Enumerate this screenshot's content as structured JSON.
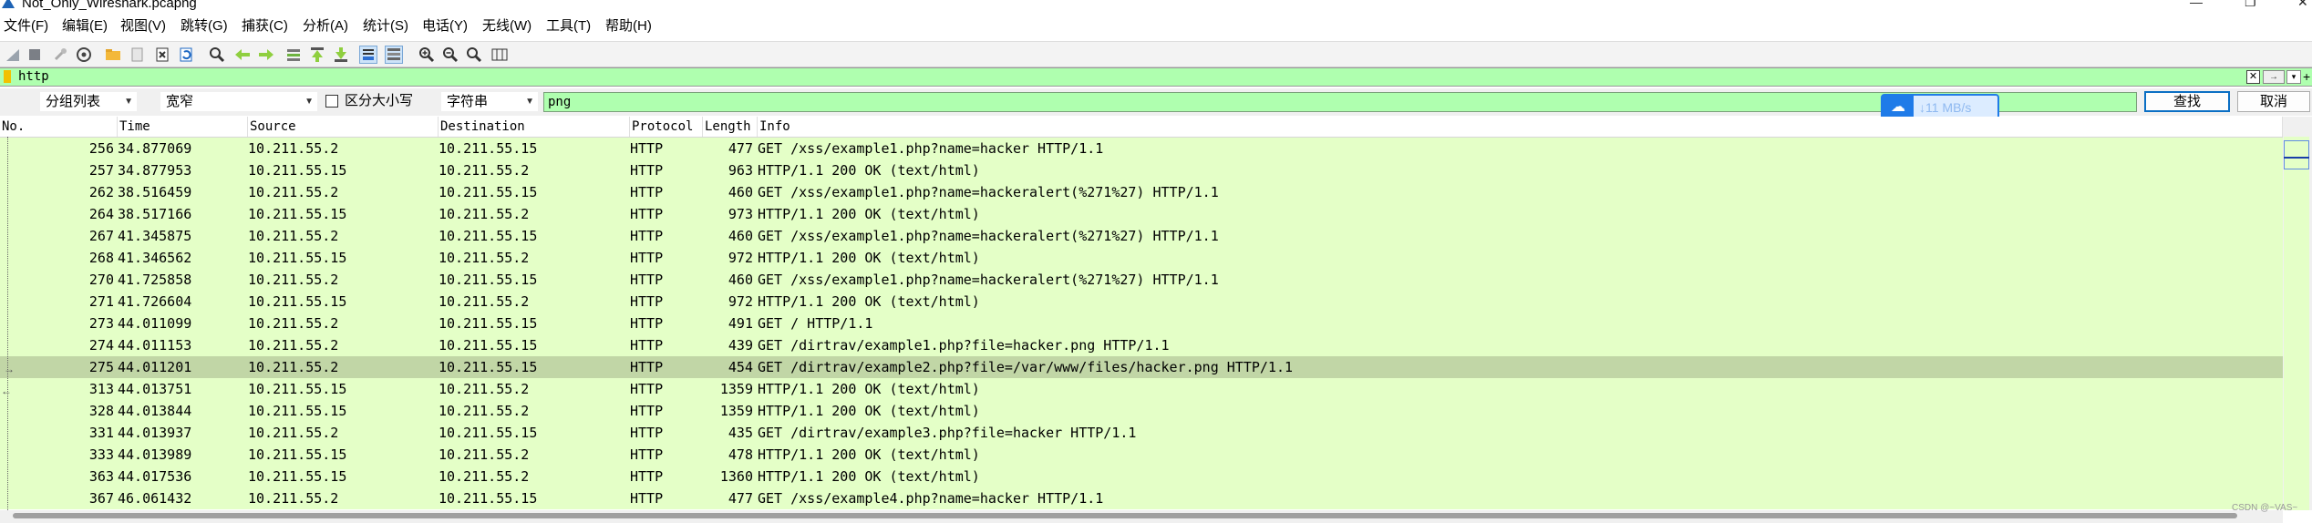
{
  "window": {
    "title": "Not_Only_Wireshark.pcapng",
    "minimize_glyph": "—",
    "maximize_glyph": "❐",
    "close_glyph": "✕"
  },
  "menu": [
    "文件(F)",
    "编辑(E)",
    "视图(V)",
    "跳转(G)",
    "捕获(C)",
    "分析(A)",
    "统计(S)",
    "电话(Y)",
    "无线(W)",
    "工具(T)",
    "帮助(H)"
  ],
  "toolbar_icons": [
    "shark-fin-icon",
    "stop-icon",
    "restart-icon",
    "options-icon",
    "open-folder-icon",
    "file-icon",
    "close-file-icon",
    "reload-icon",
    "find-icon",
    "back-icon",
    "forward-icon",
    "goto-icon",
    "first-icon",
    "last-icon",
    "autoscroll-icon",
    "colorize-icon",
    "zoom-in-icon",
    "zoom-out-icon",
    "zoom-normal-icon",
    "resize-columns-icon"
  ],
  "display_filter": {
    "value": "http",
    "clear_glyph": "✕",
    "apply_glyph": "→",
    "dropdown_glyph": "▾",
    "add_glyph": "+"
  },
  "find_bar": {
    "search_in": "分组列表",
    "char_width": "宽窄",
    "case_sensitive_label": "区分大小写",
    "search_type": "字符串",
    "search_value": "png",
    "find_button": "查找",
    "cancel_button": "取消"
  },
  "download_badge": {
    "speed": "↓11 MB/s"
  },
  "packet_list": {
    "columns": [
      "No.",
      "Time",
      "Source",
      "Destination",
      "Protocol",
      "Length",
      "Info"
    ],
    "rows": [
      {
        "no": "256",
        "time": "34.877069",
        "src": "10.211.55.2",
        "dst": "10.211.55.15",
        "proto": "HTTP",
        "len": "477",
        "info": "GET /xss/example1.php?name=hacker HTTP/1.1"
      },
      {
        "no": "257",
        "time": "34.877953",
        "src": "10.211.55.15",
        "dst": "10.211.55.2",
        "proto": "HTTP",
        "len": "963",
        "info": "HTTP/1.1 200 OK  (text/html)"
      },
      {
        "no": "262",
        "time": "38.516459",
        "src": "10.211.55.2",
        "dst": "10.211.55.15",
        "proto": "HTTP",
        "len": "460",
        "info": "GET /xss/example1.php?name=hackeralert(%271%27) HTTP/1.1"
      },
      {
        "no": "264",
        "time": "38.517166",
        "src": "10.211.55.15",
        "dst": "10.211.55.2",
        "proto": "HTTP",
        "len": "973",
        "info": "HTTP/1.1 200 OK  (text/html)"
      },
      {
        "no": "267",
        "time": "41.345875",
        "src": "10.211.55.2",
        "dst": "10.211.55.15",
        "proto": "HTTP",
        "len": "460",
        "info": "GET /xss/example1.php?name=hackeralert(%271%27) HTTP/1.1"
      },
      {
        "no": "268",
        "time": "41.346562",
        "src": "10.211.55.15",
        "dst": "10.211.55.2",
        "proto": "HTTP",
        "len": "972",
        "info": "HTTP/1.1 200 OK  (text/html)"
      },
      {
        "no": "270",
        "time": "41.725858",
        "src": "10.211.55.2",
        "dst": "10.211.55.15",
        "proto": "HTTP",
        "len": "460",
        "info": "GET /xss/example1.php?name=hackeralert(%271%27) HTTP/1.1"
      },
      {
        "no": "271",
        "time": "41.726604",
        "src": "10.211.55.15",
        "dst": "10.211.55.2",
        "proto": "HTTP",
        "len": "972",
        "info": "HTTP/1.1 200 OK  (text/html)"
      },
      {
        "no": "273",
        "time": "44.011099",
        "src": "10.211.55.2",
        "dst": "10.211.55.15",
        "proto": "HTTP",
        "len": "491",
        "info": "GET / HTTP/1.1"
      },
      {
        "no": "274",
        "time": "44.011153",
        "src": "10.211.55.2",
        "dst": "10.211.55.15",
        "proto": "HTTP",
        "len": "439",
        "info": "GET /dirtrav/example1.php?file=hacker.png HTTP/1.1"
      },
      {
        "no": "275",
        "time": "44.011201",
        "src": "10.211.55.2",
        "dst": "10.211.55.15",
        "proto": "HTTP",
        "len": "454",
        "info": "GET /dirtrav/example2.php?file=/var/www/files/hacker.png HTTP/1.1"
      },
      {
        "no": "313",
        "time": "44.013751",
        "src": "10.211.55.15",
        "dst": "10.211.55.2",
        "proto": "HTTP",
        "len": "1359",
        "info": "HTTP/1.1 200 OK  (text/html)"
      },
      {
        "no": "328",
        "time": "44.013844",
        "src": "10.211.55.15",
        "dst": "10.211.55.2",
        "proto": "HTTP",
        "len": "1359",
        "info": "HTTP/1.1 200 OK  (text/html)"
      },
      {
        "no": "331",
        "time": "44.013937",
        "src": "10.211.55.2",
        "dst": "10.211.55.15",
        "proto": "HTTP",
        "len": "435",
        "info": "GET /dirtrav/example3.php?file=hacker HTTP/1.1"
      },
      {
        "no": "333",
        "time": "44.013989",
        "src": "10.211.55.15",
        "dst": "10.211.55.2",
        "proto": "HTTP",
        "len": "478",
        "info": "HTTP/1.1 200 OK  (text/html)"
      },
      {
        "no": "363",
        "time": "44.017536",
        "src": "10.211.55.15",
        "dst": "10.211.55.2",
        "proto": "HTTP",
        "len": "1360",
        "info": "HTTP/1.1 200 OK  (text/html)"
      },
      {
        "no": "367",
        "time": "46.061432",
        "src": "10.211.55.2",
        "dst": "10.211.55.15",
        "proto": "HTTP",
        "len": "477",
        "info": "GET /xss/example4.php?name=hacker HTTP/1.1"
      }
    ],
    "selected_no": "275",
    "row_color": "#e4ffc7",
    "selected_color": "#c1d6a6"
  },
  "watermark": "CSDN @~VAS~"
}
